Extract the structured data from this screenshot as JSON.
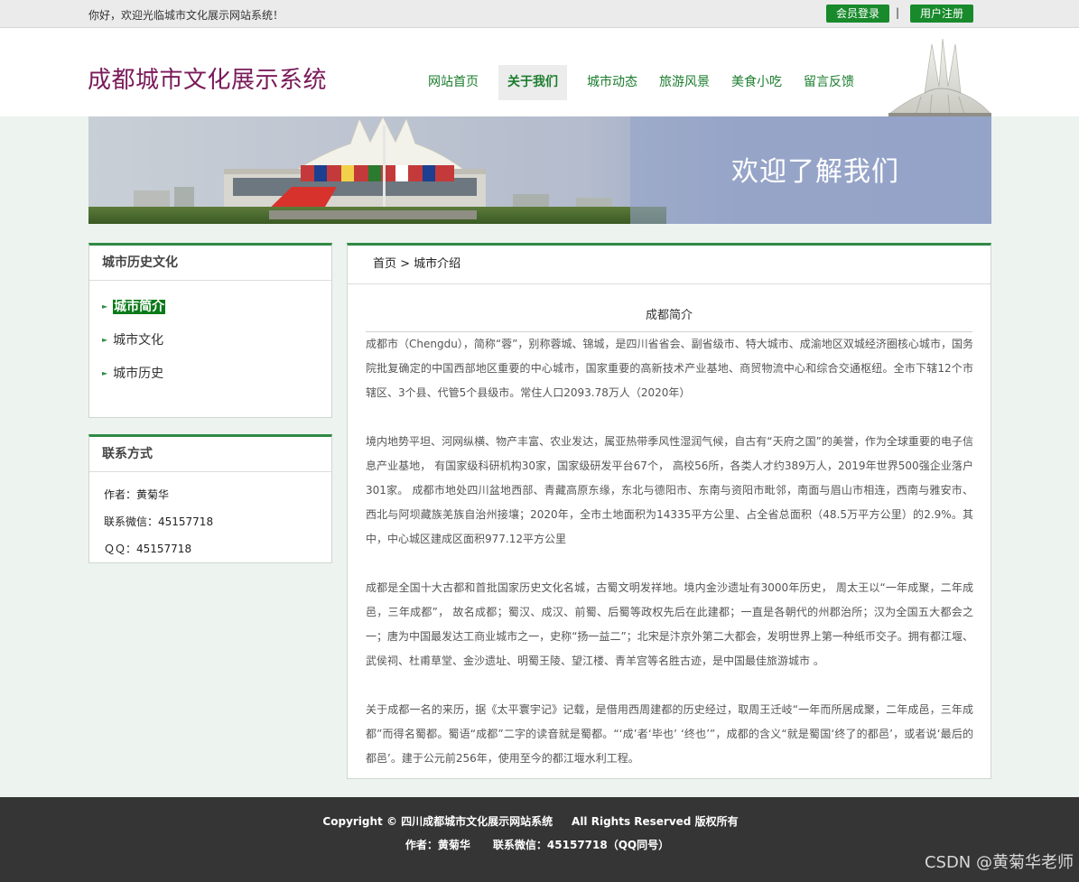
{
  "topbar": {
    "welcome": "你好，欢迎光临城市文化展示网站系统！",
    "login": "会员登录",
    "separator": "|",
    "register": "用户注册"
  },
  "header": {
    "title": "成都城市文化展示系统",
    "nav": [
      "网站首页",
      "关于我们",
      "城市动态",
      "旅游风景",
      "美食小吃",
      "留言反馈"
    ],
    "active_nav": "关于我们"
  },
  "banner": {
    "text": "欢迎了解我们"
  },
  "sidebar": {
    "history": {
      "title": "城市历史文化",
      "items": [
        "城市简介",
        "城市文化",
        "城市历史"
      ]
    },
    "contact": {
      "title": "联系方式",
      "author": "作者：黄菊华",
      "wechat": "联系微信：45157718",
      "qq": "ＱＱ：45157718"
    }
  },
  "main": {
    "breadcrumb": "首页 > 城市介绍",
    "article_title": "成都简介",
    "paragraphs": [
      "成都市（Chengdu），简称“蓉”，别称蓉城、锦城，是四川省省会、副省级市、特大城市、成渝地区双城经济圈核心城市，国务院批复确定的中国西部地区重要的中心城市，国家重要的高新技术产业基地、商贸物流中心和综合交通枢纽。全市下辖12个市辖区、3个县、代管5个县级市。常住人口2093.78万人（2020年）",
      "境内地势平坦、河网纵横、物产丰富、农业发达，属亚热带季风性湿润气候，自古有“天府之国”的美誉，作为全球重要的电子信息产业基地， 有国家级科研机构30家，国家级研发平台67个， 高校56所，各类人才约389万人，2019年世界500强企业落户301家。 成都市地处四川盆地西部、青藏高原东缘，东北与德阳市、东南与资阳市毗邻，南面与眉山市相连，西南与雅安市、西北与阿坝藏族羌族自治州接壤；2020年，全市土地面积为14335平方公里、占全省总面积（48.5万平方公里）的2.9%。其中，中心城区建成区面积977.12平方公里",
      "成都是全国十大古都和首批国家历史文化名城，古蜀文明发祥地。境内金沙遗址有3000年历史， 周太王以“一年成聚，二年成邑，三年成都”， 故名成都；蜀汉、成汉、前蜀、后蜀等政权先后在此建都；一直是各朝代的州郡治所；汉为全国五大都会之一；唐为中国最发达工商业城市之一，史称“扬一益二”；北宋是汴京外第二大都会，发明世界上第一种纸币交子。拥有都江堰、武侯祠、杜甫草堂、金沙遗址、明蜀王陵、望江楼、青羊宫等名胜古迹，是中国最佳旅游城市 。",
      "关于成都一名的来历，据《太平寰宇记》记载，是借用西周建都的历史经过，取周王迁岐“一年而所居成聚，二年成邑，三年成都”而得名蜀都。蜀语“成都”二字的读音就是蜀都。“‘成’者‘毕也’ ‘终也’”，成都的含义“就是蜀国‘终了的都邑’，或者说‘最后的都邑’。建于公元前256年，使用至今的都江堰水利工程。"
    ]
  },
  "footer": {
    "line1": "Copyright © 四川成都城市文化展示网站系统     All Rights Reserved 版权所有",
    "line2": "作者：黄菊华      联系微信：45157718（QQ同号）"
  },
  "watermark": "CSDN @黄菊华老师",
  "colors": {
    "accent_green": "#188a2c",
    "title_purple": "#7a1a5a",
    "footer_bg": "#353535"
  }
}
